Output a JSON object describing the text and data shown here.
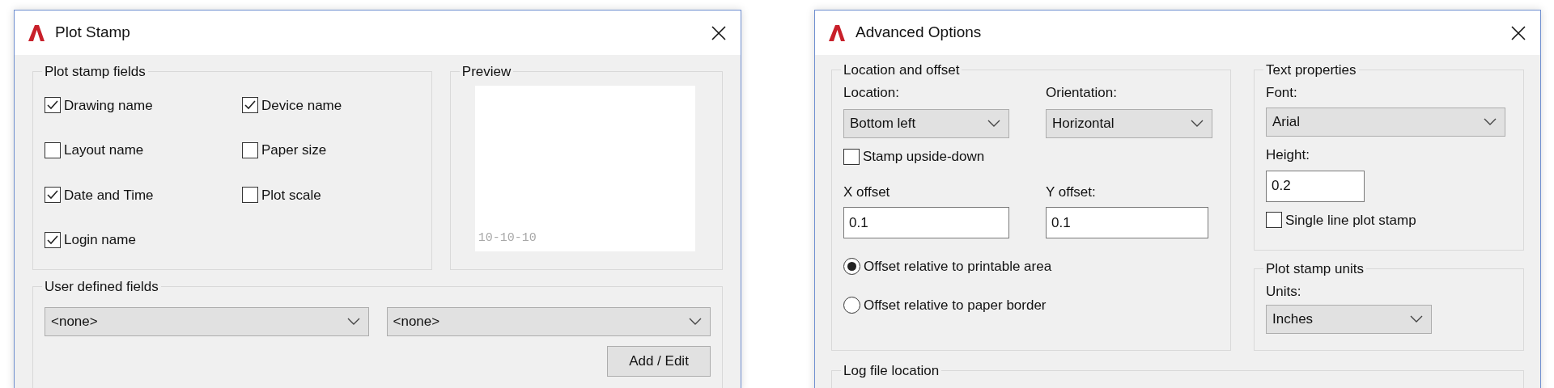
{
  "plot_stamp_dialog": {
    "title": "Plot Stamp",
    "fields_group": {
      "label": "Plot stamp fields",
      "checkboxes": [
        {
          "label": "Drawing name",
          "checked": true
        },
        {
          "label": "Device name",
          "checked": true
        },
        {
          "label": "Layout name",
          "checked": false
        },
        {
          "label": "Paper size",
          "checked": false
        },
        {
          "label": "Date and Time",
          "checked": true
        },
        {
          "label": "Plot scale",
          "checked": false
        },
        {
          "label": "Login name",
          "checked": true
        }
      ]
    },
    "preview": {
      "label": "Preview",
      "stamp_text": "10-10-10"
    },
    "user_fields": {
      "label": "User defined fields",
      "dropdowns": [
        {
          "value": "<none>"
        },
        {
          "value": "<none>"
        }
      ],
      "button": "Add / Edit"
    }
  },
  "advanced_options_dialog": {
    "title": "Advanced Options",
    "location_group": {
      "label": "Location and offset",
      "location": {
        "label": "Location:",
        "value": "Bottom left"
      },
      "orientation": {
        "label": "Orientation:",
        "value": "Horizontal"
      },
      "upside_down": {
        "label": "Stamp upside-down",
        "checked": false
      },
      "x_offset": {
        "label": "X offset",
        "value": "0.1"
      },
      "y_offset": {
        "label": "Y offset:",
        "value": "0.1"
      },
      "radios": [
        {
          "label": "Offset relative to printable area",
          "selected": true
        },
        {
          "label": "Offset relative to paper border",
          "selected": false
        }
      ]
    },
    "text_properties": {
      "label": "Text properties",
      "font": {
        "label": "Font:",
        "value": "Arial"
      },
      "height": {
        "label": "Height:",
        "value": "0.2"
      },
      "single_line": {
        "label": "Single line plot stamp",
        "checked": false
      }
    },
    "units_group": {
      "label": "Plot stamp units",
      "units": {
        "label": "Units:",
        "value": "Inches"
      }
    },
    "log_group": {
      "label": "Log file location"
    }
  }
}
